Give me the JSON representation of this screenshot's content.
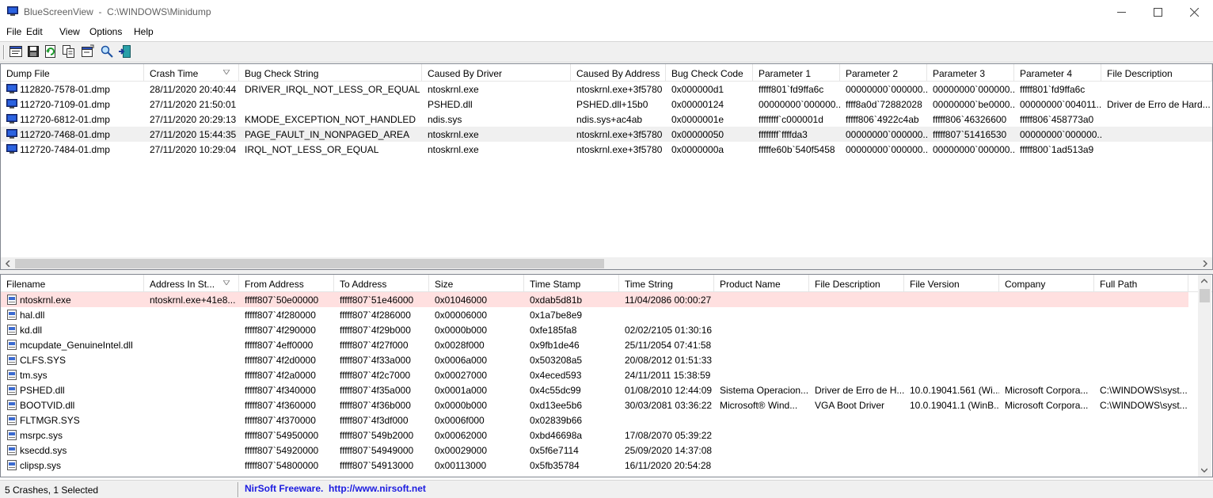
{
  "window": {
    "title": "BlueScreenView  -  C:\\WINDOWS\\Minidump"
  },
  "menu": [
    "File",
    "Edit",
    "View",
    "Options",
    "Help"
  ],
  "toolbar": {
    "icons": [
      "properties-icon",
      "save-icon",
      "refresh-icon",
      "copy-icon",
      "advanced-options-icon",
      "find-icon",
      "exit-icon"
    ]
  },
  "crashes": {
    "columns": [
      "Dump File",
      "Crash Time",
      "Bug Check String",
      "Caused By Driver",
      "Caused By Address",
      "Bug Check Code",
      "Parameter 1",
      "Parameter 2",
      "Parameter 3",
      "Parameter 4",
      "File Description"
    ],
    "sorted_column": "Crash Time",
    "selected_row": 3,
    "rows": [
      [
        "112820-7578-01.dmp",
        "28/11/2020 20:40:44",
        "DRIVER_IRQL_NOT_LESS_OR_EQUAL",
        "ntoskrnl.exe",
        "ntoskrnl.exe+3f5780",
        "0x000000d1",
        "fffff801`fd9ffa6c",
        "00000000`000000...",
        "00000000`000000...",
        "fffff801`fd9ffa6c",
        ""
      ],
      [
        "112720-7109-01.dmp",
        "27/11/2020 21:50:01",
        "",
        "PSHED.dll",
        "PSHED.dll+15b0",
        "0x00000124",
        "00000000`000000...",
        "ffff8a0d`72882028",
        "00000000`be0000...",
        "00000000`004011...",
        "Driver de Erro de Hard..."
      ],
      [
        "112720-6812-01.dmp",
        "27/11/2020 20:29:13",
        "KMODE_EXCEPTION_NOT_HANDLED",
        "ndis.sys",
        "ndis.sys+ac4ab",
        "0x0000001e",
        "ffffffff`c000001d",
        "fffff806`4922c4ab",
        "fffff806`46326600",
        "fffff806`458773a0",
        ""
      ],
      [
        "112720-7468-01.dmp",
        "27/11/2020 15:44:35",
        "PAGE_FAULT_IN_NONPAGED_AREA",
        "ntoskrnl.exe",
        "ntoskrnl.exe+3f5780",
        "0x00000050",
        "ffffffff`ffffda3",
        "00000000`000000...",
        "fffff807`51416530",
        "00000000`000000...",
        ""
      ],
      [
        "112720-7484-01.dmp",
        "27/11/2020 10:29:04",
        "IRQL_NOT_LESS_OR_EQUAL",
        "ntoskrnl.exe",
        "ntoskrnl.exe+3f5780",
        "0x0000000a",
        "fffffe60b`540f5458",
        "00000000`000000...",
        "00000000`000000...",
        "fffff800`1ad513a9",
        ""
      ]
    ]
  },
  "drivers": {
    "columns": [
      "Filename",
      "Address In St...",
      "From Address",
      "To Address",
      "Size",
      "Time Stamp",
      "Time String",
      "Product Name",
      "File Description",
      "File Version",
      "Company",
      "Full Path"
    ],
    "sorted_column": "Address In St...",
    "highlight_color": "#ffe0e0",
    "rows": [
      [
        "ntoskrnl.exe",
        "ntoskrnl.exe+41e8...",
        "fffff807`50e00000",
        "fffff807`51e46000",
        "0x01046000",
        "0xdab5d81b",
        "11/04/2086 00:00:27",
        "",
        "",
        "",
        "",
        ""
      ],
      [
        "hal.dll",
        "",
        "fffff807`4f280000",
        "fffff807`4f286000",
        "0x00006000",
        "0x1a7be8e9",
        "",
        "",
        "",
        "",
        "",
        ""
      ],
      [
        "kd.dll",
        "",
        "fffff807`4f290000",
        "fffff807`4f29b000",
        "0x0000b000",
        "0xfe185fa8",
        "02/02/2105 01:30:16",
        "",
        "",
        "",
        "",
        ""
      ],
      [
        "mcupdate_GenuineIntel.dll",
        "",
        "fffff807`4eff0000",
        "fffff807`4f27f000",
        "0x0028f000",
        "0x9fb1de46",
        "25/11/2054 07:41:58",
        "",
        "",
        "",
        "",
        ""
      ],
      [
        "CLFS.SYS",
        "",
        "fffff807`4f2d0000",
        "fffff807`4f33a000",
        "0x0006a000",
        "0x503208a5",
        "20/08/2012 01:51:33",
        "",
        "",
        "",
        "",
        ""
      ],
      [
        "tm.sys",
        "",
        "fffff807`4f2a0000",
        "fffff807`4f2c7000",
        "0x00027000",
        "0x4eced593",
        "24/11/2011 15:38:59",
        "",
        "",
        "",
        "",
        ""
      ],
      [
        "PSHED.dll",
        "",
        "fffff807`4f340000",
        "fffff807`4f35a000",
        "0x0001a000",
        "0x4c55dc99",
        "01/08/2010 12:44:09",
        "Sistema Operacion...",
        "Driver de Erro de H...",
        "10.0.19041.561 (Wi...",
        "Microsoft Corpora...",
        "C:\\WINDOWS\\syst..."
      ],
      [
        "BOOTVID.dll",
        "",
        "fffff807`4f360000",
        "fffff807`4f36b000",
        "0x0000b000",
        "0xd13ee5b6",
        "30/03/2081 03:36:22",
        "Microsoft® Wind...",
        "VGA Boot Driver",
        "10.0.19041.1 (WinB...",
        "Microsoft Corpora...",
        "C:\\WINDOWS\\syst..."
      ],
      [
        "FLTMGR.SYS",
        "",
        "fffff807`4f370000",
        "fffff807`4f3df000",
        "0x0006f000",
        "0x02839b66",
        "",
        "",
        "",
        "",
        "",
        ""
      ],
      [
        "msrpc.sys",
        "",
        "fffff807`54950000",
        "fffff807`549b2000",
        "0x00062000",
        "0xbd46698a",
        "17/08/2070 05:39:22",
        "",
        "",
        "",
        "",
        ""
      ],
      [
        "ksecdd.sys",
        "",
        "fffff807`54920000",
        "fffff807`54949000",
        "0x00029000",
        "0x5f6e7114",
        "25/09/2020 14:37:08",
        "",
        "",
        "",
        "",
        ""
      ],
      [
        "clipsp.sys",
        "",
        "fffff807`54800000",
        "fffff807`54913000",
        "0x00113000",
        "0x5fb35784",
        "16/11/2020 20:54:28",
        "",
        "",
        "",
        "",
        ""
      ]
    ]
  },
  "status": {
    "left": "5 Crashes, 1 Selected",
    "right": "NirSoft Freeware.  http://www.nirsoft.net"
  }
}
